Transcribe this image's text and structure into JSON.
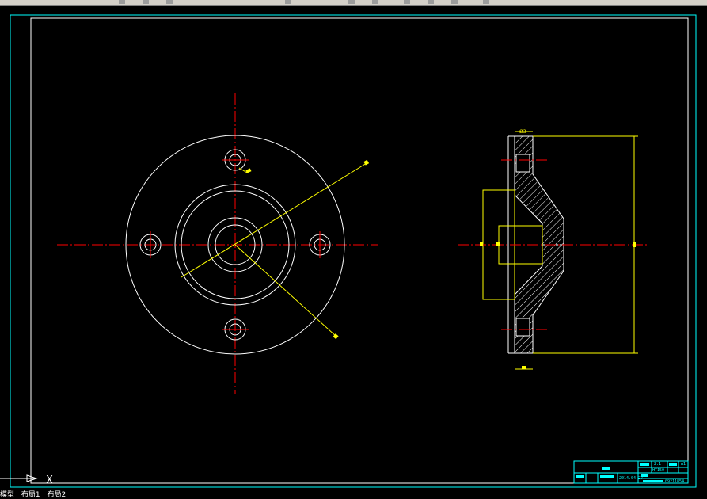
{
  "colors": {
    "background": "#000000",
    "frame": "#00ffff",
    "object": "#ffffff",
    "centerline": "#ff0000",
    "dimension": "#ffff00",
    "title_block": "#00ffff"
  },
  "title_block": {
    "scale": "2:1",
    "sheet": "A1",
    "material": "HT150",
    "date": "2014.04.27",
    "number": "09211854"
  },
  "ucs": {
    "axis_label": "X"
  },
  "layout_tabs": [
    {
      "label": "模型",
      "active": true
    },
    {
      "label": "布局1",
      "active": false
    },
    {
      "label": "布局2",
      "active": false
    }
  ],
  "section_labels": {
    "top_dim": "Ø3"
  }
}
